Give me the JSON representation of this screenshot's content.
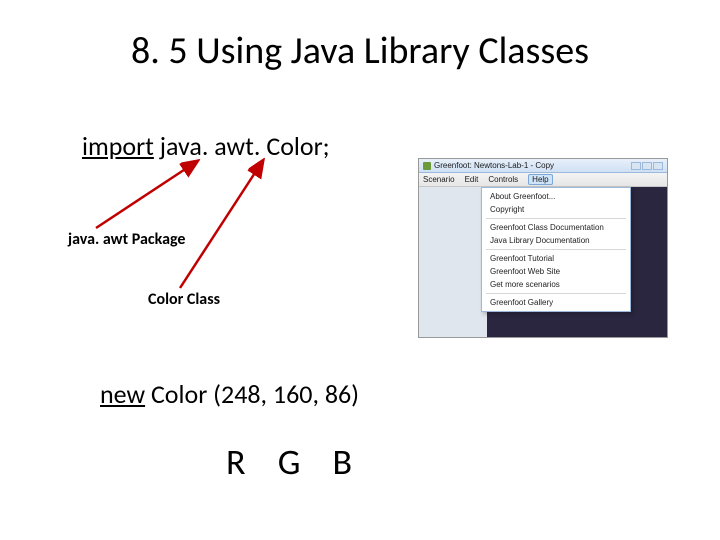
{
  "title": "8. 5 Using Java Library Classes",
  "import_line": {
    "keyword": "import",
    "rest": " java. awt. Color;"
  },
  "labels": {
    "package": "java. awt Package",
    "class": "Color Class"
  },
  "new_color": {
    "keyword": "new",
    "rest": " Color (248, 160, 86)"
  },
  "rgb": {
    "r": "R",
    "g": "G",
    "b": "B"
  },
  "inset": {
    "title": "Greenfoot: Newtons-Lab-1 - Copy",
    "menu": {
      "scenario": "Scenario",
      "edit": "Edit",
      "controls": "Controls",
      "help": "Help"
    },
    "dropdown": {
      "about": "About Greenfoot...",
      "copyright": "Copyright",
      "class_doc": "Greenfoot Class Documentation",
      "java_doc": "Java Library Documentation",
      "tutorial": "Greenfoot Tutorial",
      "website": "Greenfoot Web Site",
      "scenarios": "Get more scenarios",
      "gallery": "Greenfoot Gallery"
    }
  }
}
